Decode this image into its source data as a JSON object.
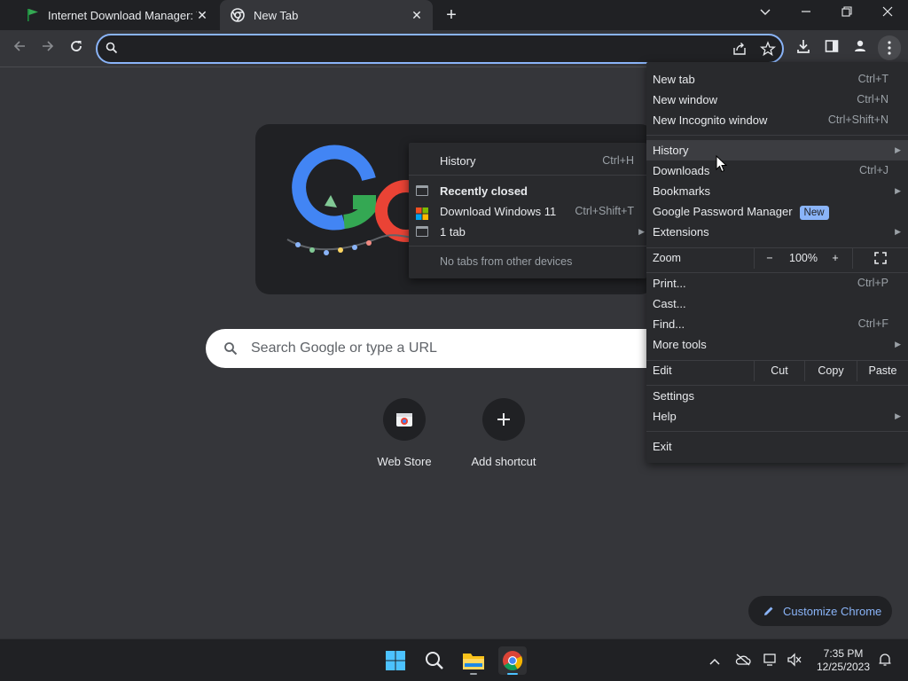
{
  "tabs": [
    {
      "title": "Internet Download Manager: The",
      "icon": "idm-flag-icon"
    },
    {
      "title": "New Tab",
      "icon": "chrome-icon"
    }
  ],
  "omnibox": {
    "value": "",
    "placeholder": ""
  },
  "ntp": {
    "search_placeholder": "Search Google or type a URL",
    "shortcuts": [
      {
        "label": "Web Store",
        "icon": "webstore-icon"
      },
      {
        "label": "Add shortcut",
        "icon": "plus-icon"
      }
    ],
    "customize_label": "Customize Chrome"
  },
  "menu": {
    "new_tab": {
      "label": "New tab",
      "shortcut": "Ctrl+T"
    },
    "new_window": {
      "label": "New window",
      "shortcut": "Ctrl+N"
    },
    "new_incognito": {
      "label": "New Incognito window",
      "shortcut": "Ctrl+Shift+N"
    },
    "history": {
      "label": "History"
    },
    "downloads": {
      "label": "Downloads",
      "shortcut": "Ctrl+J"
    },
    "bookmarks": {
      "label": "Bookmarks"
    },
    "password_manager": {
      "label": "Google Password Manager",
      "badge": "New"
    },
    "extensions": {
      "label": "Extensions"
    },
    "zoom": {
      "label": "Zoom",
      "minus": "−",
      "value": "100%",
      "plus": "+"
    },
    "print": {
      "label": "Print...",
      "shortcut": "Ctrl+P"
    },
    "cast": {
      "label": "Cast..."
    },
    "find": {
      "label": "Find...",
      "shortcut": "Ctrl+F"
    },
    "more_tools": {
      "label": "More tools"
    },
    "edit": {
      "label": "Edit",
      "cut": "Cut",
      "copy": "Copy",
      "paste": "Paste"
    },
    "settings": {
      "label": "Settings"
    },
    "help": {
      "label": "Help"
    },
    "exit": {
      "label": "Exit"
    }
  },
  "history_submenu": {
    "history": {
      "label": "History",
      "shortcut": "Ctrl+H"
    },
    "recently_closed": "Recently closed",
    "download_windows": {
      "label": "Download Windows 11",
      "shortcut": "Ctrl+Shift+T"
    },
    "one_tab": {
      "label": "1 tab"
    },
    "no_tabs": "No tabs from other devices"
  },
  "taskbar": {
    "time": "7:35 PM",
    "date": "12/25/2023"
  },
  "colors": {
    "accent": "#8ab4f8",
    "background": "#35363a",
    "menu_bg": "#292a2d"
  }
}
